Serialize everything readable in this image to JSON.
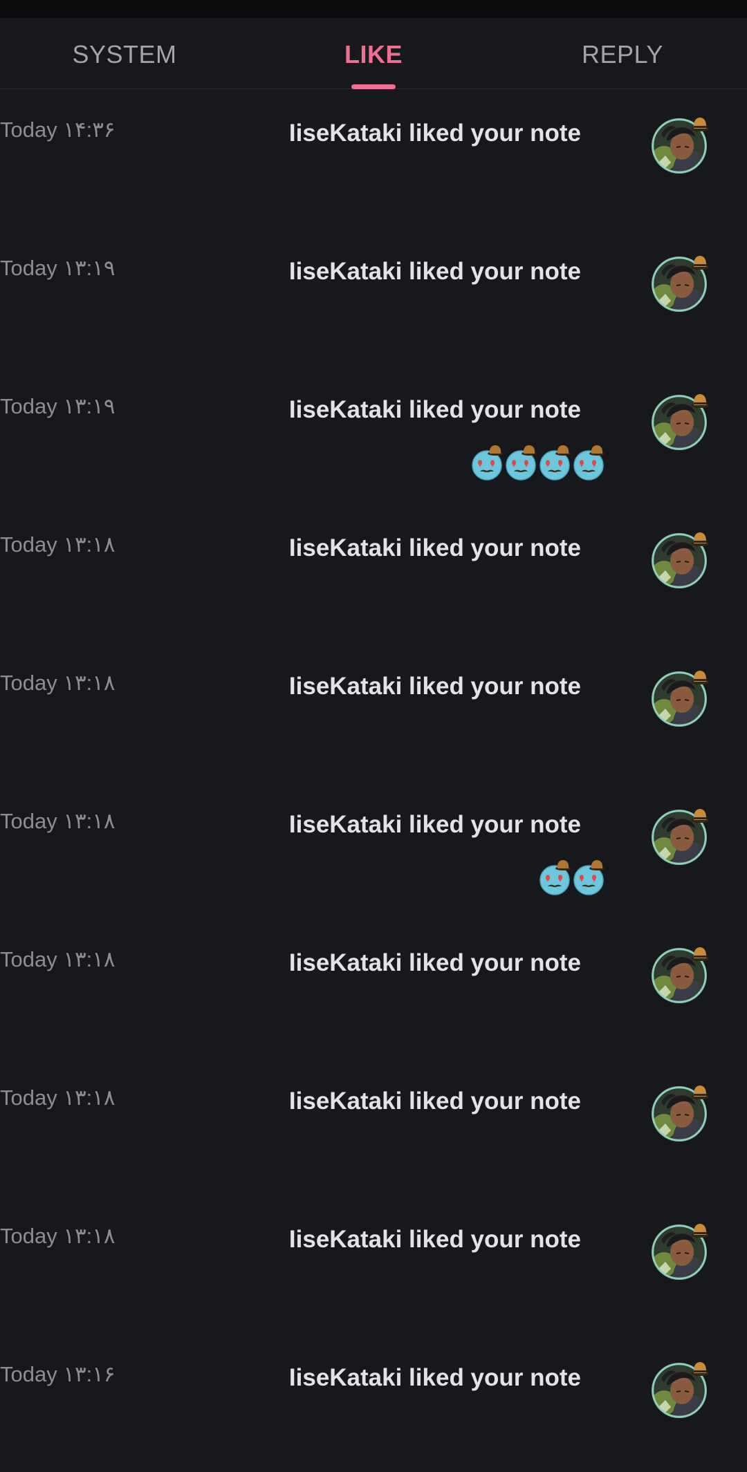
{
  "tabs": [
    {
      "label": "SYSTEM",
      "active": false
    },
    {
      "label": "LIKE",
      "active": true
    },
    {
      "label": "REPLY",
      "active": false
    }
  ],
  "colors": {
    "background": "#17181c",
    "accent": "#ef6f92",
    "tab_inactive": "#a3a4a8",
    "message_text": "#e2e3e6",
    "time_text": "#8d8e93"
  },
  "notifications": [
    {
      "message": "IiseKataki liked your note",
      "time": "Today ۱۴:۳۶",
      "emoji_count": 0
    },
    {
      "message": "IiseKataki liked your note",
      "time": "Today ۱۳:۱۹",
      "emoji_count": 0
    },
    {
      "message": "IiseKataki liked your note",
      "time": "Today ۱۳:۱۹",
      "emoji_count": 4
    },
    {
      "message": "IiseKataki liked your note",
      "time": "Today ۱۳:۱۸",
      "emoji_count": 0
    },
    {
      "message": "IiseKataki liked your note",
      "time": "Today ۱۳:۱۸",
      "emoji_count": 0
    },
    {
      "message": "IiseKataki liked your note",
      "time": "Today ۱۳:۱۸",
      "emoji_count": 2
    },
    {
      "message": "IiseKataki liked your note",
      "time": "Today ۱۳:۱۸",
      "emoji_count": 0
    },
    {
      "message": "IiseKataki liked your note",
      "time": "Today ۱۳:۱۸",
      "emoji_count": 0
    },
    {
      "message": "IiseKataki liked your note",
      "time": "Today ۱۳:۱۸",
      "emoji_count": 0
    },
    {
      "message": "IiseKataki liked your note",
      "time": "Today ۱۳:۱۶",
      "emoji_count": 0
    }
  ],
  "icons": {
    "avatar": "user-avatar-icon",
    "emoji": "heart-eyes-mustache-hat-emoji-icon"
  }
}
